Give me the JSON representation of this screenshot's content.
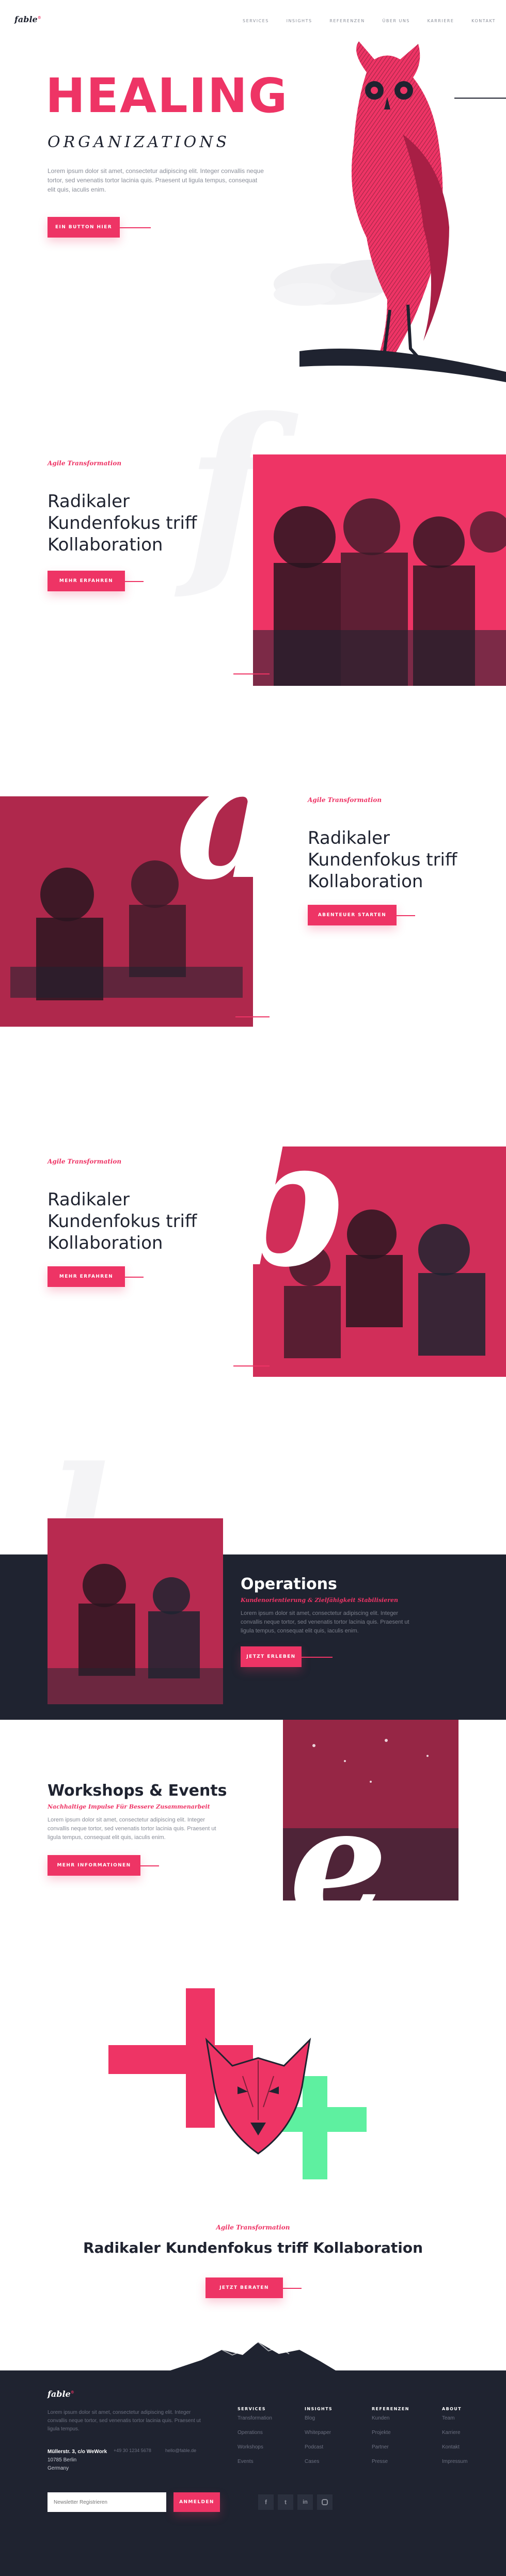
{
  "colors": {
    "accent": "#ee3465",
    "dark": "#1f2330",
    "green": "#5ef0a0"
  },
  "header": {
    "logo": "fable",
    "nav": [
      "Services",
      "Insights",
      "Referenzen",
      "Über uns",
      "Karriere",
      "Kontakt"
    ]
  },
  "hero": {
    "title": "HEALING",
    "subtitle": "ORGANIZATIONS",
    "body": "Lorem ipsum dolor sit amet, consectetur adipiscing elit. Integer convallis neque tortor, sed venenatis tortor lacinia quis. Praesent ut ligula tempus, consequat elit quis, iaculis enim.",
    "button": "Ein Button Hier"
  },
  "section_f": {
    "letter": "f",
    "tag": "Agile Transformation",
    "heading": [
      "Radikaler",
      "Kundenfokus triff",
      "Kollaboration"
    ],
    "button": "Mehr Erfahren"
  },
  "section_a": {
    "letter": "a",
    "tag": "Agile Transformation",
    "heading": [
      "Radikaler",
      "Kundenfokus triff",
      "Kollaboration"
    ],
    "button": "Abenteuer Starten"
  },
  "section_b": {
    "letter": "b",
    "tag": "Agile Transformation",
    "heading": [
      "Radikaler",
      "Kundenfokus triff",
      "Kollaboration"
    ],
    "button": "Mehr Erfahren"
  },
  "operations": {
    "letter": "l",
    "title": "Operations",
    "subtitle": "Kundenorientierung & Zielfähigkeit Stabilisieren",
    "body": "Lorem ipsum dolor sit amet, consectetur adipiscing elit. Integer convallis neque tortor, sed venenatis tortor lacinia quis. Praesent ut ligula tempus, consequat elit quis, iaculis enim.",
    "button": "Jetzt Erleben"
  },
  "workshops": {
    "letter": "e",
    "title": "Workshops & Events",
    "subtitle": "Nachhaltige Impulse Für Bessere Zusammenarbeit",
    "body": "Lorem ipsum dolor sit amet, consectetur adipiscing elit. Integer convallis neque tortor, sed venenatis tortor lacinia quis. Praesent ut ligula tempus, consequat elit quis, iaculis enim.",
    "button": "Mehr Informationen"
  },
  "cta": {
    "tag": "Agile Transformation",
    "heading": "Radikaler Kundenfokus triff Kollaboration",
    "button": "Jetzt Beraten"
  },
  "footer": {
    "logo": "fable",
    "about": "Lorem ipsum dolor sit amet, consectetur adipiscing elit. Integer convallis neque tortor, sed venenatis tortor lacinia quis. Praesent ut ligula tempus.",
    "address": [
      "Müllerstr. 3, c/o WeWork",
      "10785 Berlin",
      "Germany"
    ],
    "phone": "+49 30 1234 5678",
    "email": "hello@fable.de",
    "columns": [
      {
        "title": "Services",
        "links": [
          "Transformation",
          "Operations",
          "Workshops",
          "Events"
        ]
      },
      {
        "title": "Insights",
        "links": [
          "Blog",
          "Whitepaper",
          "Podcast",
          "Cases"
        ]
      },
      {
        "title": "Referenzen",
        "links": [
          "Kunden",
          "Projekte",
          "Partner",
          "Presse"
        ]
      },
      {
        "title": "About",
        "links": [
          "Team",
          "Karriere",
          "Kontakt",
          "Impressum"
        ]
      }
    ],
    "newsletter_placeholder": "Newsletter Registrieren",
    "newsletter_button": "Anmelden",
    "social": [
      "facebook-icon",
      "twitter-icon",
      "linkedin-icon",
      "instagram-icon"
    ]
  }
}
